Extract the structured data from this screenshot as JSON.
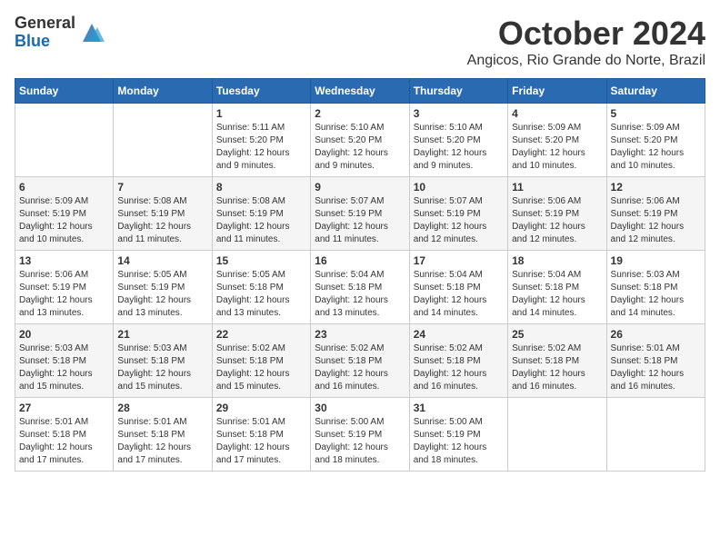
{
  "logo": {
    "general": "General",
    "blue": "Blue"
  },
  "title": "October 2024",
  "location": "Angicos, Rio Grande do Norte, Brazil",
  "days_of_week": [
    "Sunday",
    "Monday",
    "Tuesday",
    "Wednesday",
    "Thursday",
    "Friday",
    "Saturday"
  ],
  "weeks": [
    [
      {
        "day": "",
        "info": ""
      },
      {
        "day": "",
        "info": ""
      },
      {
        "day": "1",
        "info": "Sunrise: 5:11 AM\nSunset: 5:20 PM\nDaylight: 12 hours and 9 minutes."
      },
      {
        "day": "2",
        "info": "Sunrise: 5:10 AM\nSunset: 5:20 PM\nDaylight: 12 hours and 9 minutes."
      },
      {
        "day": "3",
        "info": "Sunrise: 5:10 AM\nSunset: 5:20 PM\nDaylight: 12 hours and 9 minutes."
      },
      {
        "day": "4",
        "info": "Sunrise: 5:09 AM\nSunset: 5:20 PM\nDaylight: 12 hours and 10 minutes."
      },
      {
        "day": "5",
        "info": "Sunrise: 5:09 AM\nSunset: 5:20 PM\nDaylight: 12 hours and 10 minutes."
      }
    ],
    [
      {
        "day": "6",
        "info": "Sunrise: 5:09 AM\nSunset: 5:19 PM\nDaylight: 12 hours and 10 minutes."
      },
      {
        "day": "7",
        "info": "Sunrise: 5:08 AM\nSunset: 5:19 PM\nDaylight: 12 hours and 11 minutes."
      },
      {
        "day": "8",
        "info": "Sunrise: 5:08 AM\nSunset: 5:19 PM\nDaylight: 12 hours and 11 minutes."
      },
      {
        "day": "9",
        "info": "Sunrise: 5:07 AM\nSunset: 5:19 PM\nDaylight: 12 hours and 11 minutes."
      },
      {
        "day": "10",
        "info": "Sunrise: 5:07 AM\nSunset: 5:19 PM\nDaylight: 12 hours and 12 minutes."
      },
      {
        "day": "11",
        "info": "Sunrise: 5:06 AM\nSunset: 5:19 PM\nDaylight: 12 hours and 12 minutes."
      },
      {
        "day": "12",
        "info": "Sunrise: 5:06 AM\nSunset: 5:19 PM\nDaylight: 12 hours and 12 minutes."
      }
    ],
    [
      {
        "day": "13",
        "info": "Sunrise: 5:06 AM\nSunset: 5:19 PM\nDaylight: 12 hours and 13 minutes."
      },
      {
        "day": "14",
        "info": "Sunrise: 5:05 AM\nSunset: 5:19 PM\nDaylight: 12 hours and 13 minutes."
      },
      {
        "day": "15",
        "info": "Sunrise: 5:05 AM\nSunset: 5:18 PM\nDaylight: 12 hours and 13 minutes."
      },
      {
        "day": "16",
        "info": "Sunrise: 5:04 AM\nSunset: 5:18 PM\nDaylight: 12 hours and 13 minutes."
      },
      {
        "day": "17",
        "info": "Sunrise: 5:04 AM\nSunset: 5:18 PM\nDaylight: 12 hours and 14 minutes."
      },
      {
        "day": "18",
        "info": "Sunrise: 5:04 AM\nSunset: 5:18 PM\nDaylight: 12 hours and 14 minutes."
      },
      {
        "day": "19",
        "info": "Sunrise: 5:03 AM\nSunset: 5:18 PM\nDaylight: 12 hours and 14 minutes."
      }
    ],
    [
      {
        "day": "20",
        "info": "Sunrise: 5:03 AM\nSunset: 5:18 PM\nDaylight: 12 hours and 15 minutes."
      },
      {
        "day": "21",
        "info": "Sunrise: 5:03 AM\nSunset: 5:18 PM\nDaylight: 12 hours and 15 minutes."
      },
      {
        "day": "22",
        "info": "Sunrise: 5:02 AM\nSunset: 5:18 PM\nDaylight: 12 hours and 15 minutes."
      },
      {
        "day": "23",
        "info": "Sunrise: 5:02 AM\nSunset: 5:18 PM\nDaylight: 12 hours and 16 minutes."
      },
      {
        "day": "24",
        "info": "Sunrise: 5:02 AM\nSunset: 5:18 PM\nDaylight: 12 hours and 16 minutes."
      },
      {
        "day": "25",
        "info": "Sunrise: 5:02 AM\nSunset: 5:18 PM\nDaylight: 12 hours and 16 minutes."
      },
      {
        "day": "26",
        "info": "Sunrise: 5:01 AM\nSunset: 5:18 PM\nDaylight: 12 hours and 16 minutes."
      }
    ],
    [
      {
        "day": "27",
        "info": "Sunrise: 5:01 AM\nSunset: 5:18 PM\nDaylight: 12 hours and 17 minutes."
      },
      {
        "day": "28",
        "info": "Sunrise: 5:01 AM\nSunset: 5:18 PM\nDaylight: 12 hours and 17 minutes."
      },
      {
        "day": "29",
        "info": "Sunrise: 5:01 AM\nSunset: 5:18 PM\nDaylight: 12 hours and 17 minutes."
      },
      {
        "day": "30",
        "info": "Sunrise: 5:00 AM\nSunset: 5:19 PM\nDaylight: 12 hours and 18 minutes."
      },
      {
        "day": "31",
        "info": "Sunrise: 5:00 AM\nSunset: 5:19 PM\nDaylight: 12 hours and 18 minutes."
      },
      {
        "day": "",
        "info": ""
      },
      {
        "day": "",
        "info": ""
      }
    ]
  ]
}
